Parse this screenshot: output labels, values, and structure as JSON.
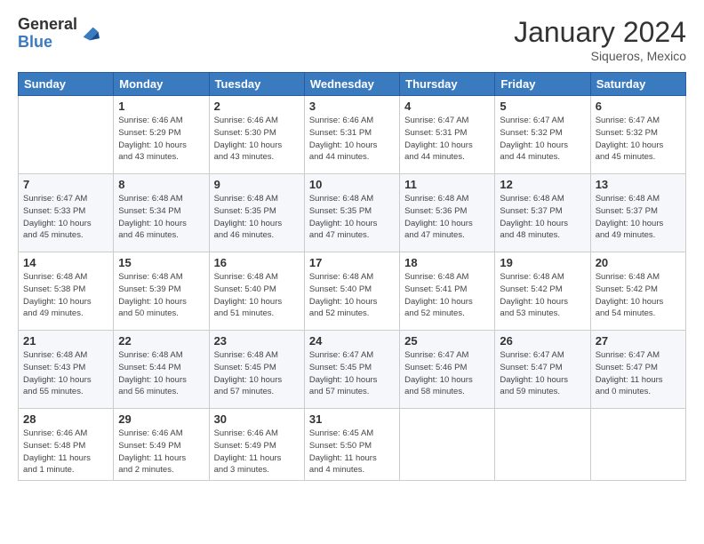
{
  "logo": {
    "general": "General",
    "blue": "Blue"
  },
  "header": {
    "month": "January 2024",
    "location": "Siqueros, Mexico"
  },
  "weekdays": [
    "Sunday",
    "Monday",
    "Tuesday",
    "Wednesday",
    "Thursday",
    "Friday",
    "Saturday"
  ],
  "weeks": [
    [
      {
        "day": "",
        "info": ""
      },
      {
        "day": "1",
        "info": "Sunrise: 6:46 AM\nSunset: 5:29 PM\nDaylight: 10 hours\nand 43 minutes."
      },
      {
        "day": "2",
        "info": "Sunrise: 6:46 AM\nSunset: 5:30 PM\nDaylight: 10 hours\nand 43 minutes."
      },
      {
        "day": "3",
        "info": "Sunrise: 6:46 AM\nSunset: 5:31 PM\nDaylight: 10 hours\nand 44 minutes."
      },
      {
        "day": "4",
        "info": "Sunrise: 6:47 AM\nSunset: 5:31 PM\nDaylight: 10 hours\nand 44 minutes."
      },
      {
        "day": "5",
        "info": "Sunrise: 6:47 AM\nSunset: 5:32 PM\nDaylight: 10 hours\nand 44 minutes."
      },
      {
        "day": "6",
        "info": "Sunrise: 6:47 AM\nSunset: 5:32 PM\nDaylight: 10 hours\nand 45 minutes."
      }
    ],
    [
      {
        "day": "7",
        "info": "Sunrise: 6:47 AM\nSunset: 5:33 PM\nDaylight: 10 hours\nand 45 minutes."
      },
      {
        "day": "8",
        "info": "Sunrise: 6:48 AM\nSunset: 5:34 PM\nDaylight: 10 hours\nand 46 minutes."
      },
      {
        "day": "9",
        "info": "Sunrise: 6:48 AM\nSunset: 5:35 PM\nDaylight: 10 hours\nand 46 minutes."
      },
      {
        "day": "10",
        "info": "Sunrise: 6:48 AM\nSunset: 5:35 PM\nDaylight: 10 hours\nand 47 minutes."
      },
      {
        "day": "11",
        "info": "Sunrise: 6:48 AM\nSunset: 5:36 PM\nDaylight: 10 hours\nand 47 minutes."
      },
      {
        "day": "12",
        "info": "Sunrise: 6:48 AM\nSunset: 5:37 PM\nDaylight: 10 hours\nand 48 minutes."
      },
      {
        "day": "13",
        "info": "Sunrise: 6:48 AM\nSunset: 5:37 PM\nDaylight: 10 hours\nand 49 minutes."
      }
    ],
    [
      {
        "day": "14",
        "info": "Sunrise: 6:48 AM\nSunset: 5:38 PM\nDaylight: 10 hours\nand 49 minutes."
      },
      {
        "day": "15",
        "info": "Sunrise: 6:48 AM\nSunset: 5:39 PM\nDaylight: 10 hours\nand 50 minutes."
      },
      {
        "day": "16",
        "info": "Sunrise: 6:48 AM\nSunset: 5:40 PM\nDaylight: 10 hours\nand 51 minutes."
      },
      {
        "day": "17",
        "info": "Sunrise: 6:48 AM\nSunset: 5:40 PM\nDaylight: 10 hours\nand 52 minutes."
      },
      {
        "day": "18",
        "info": "Sunrise: 6:48 AM\nSunset: 5:41 PM\nDaylight: 10 hours\nand 52 minutes."
      },
      {
        "day": "19",
        "info": "Sunrise: 6:48 AM\nSunset: 5:42 PM\nDaylight: 10 hours\nand 53 minutes."
      },
      {
        "day": "20",
        "info": "Sunrise: 6:48 AM\nSunset: 5:42 PM\nDaylight: 10 hours\nand 54 minutes."
      }
    ],
    [
      {
        "day": "21",
        "info": "Sunrise: 6:48 AM\nSunset: 5:43 PM\nDaylight: 10 hours\nand 55 minutes."
      },
      {
        "day": "22",
        "info": "Sunrise: 6:48 AM\nSunset: 5:44 PM\nDaylight: 10 hours\nand 56 minutes."
      },
      {
        "day": "23",
        "info": "Sunrise: 6:48 AM\nSunset: 5:45 PM\nDaylight: 10 hours\nand 57 minutes."
      },
      {
        "day": "24",
        "info": "Sunrise: 6:47 AM\nSunset: 5:45 PM\nDaylight: 10 hours\nand 57 minutes."
      },
      {
        "day": "25",
        "info": "Sunrise: 6:47 AM\nSunset: 5:46 PM\nDaylight: 10 hours\nand 58 minutes."
      },
      {
        "day": "26",
        "info": "Sunrise: 6:47 AM\nSunset: 5:47 PM\nDaylight: 10 hours\nand 59 minutes."
      },
      {
        "day": "27",
        "info": "Sunrise: 6:47 AM\nSunset: 5:47 PM\nDaylight: 11 hours\nand 0 minutes."
      }
    ],
    [
      {
        "day": "28",
        "info": "Sunrise: 6:46 AM\nSunset: 5:48 PM\nDaylight: 11 hours\nand 1 minute."
      },
      {
        "day": "29",
        "info": "Sunrise: 6:46 AM\nSunset: 5:49 PM\nDaylight: 11 hours\nand 2 minutes."
      },
      {
        "day": "30",
        "info": "Sunrise: 6:46 AM\nSunset: 5:49 PM\nDaylight: 11 hours\nand 3 minutes."
      },
      {
        "day": "31",
        "info": "Sunrise: 6:45 AM\nSunset: 5:50 PM\nDaylight: 11 hours\nand 4 minutes."
      },
      {
        "day": "",
        "info": ""
      },
      {
        "day": "",
        "info": ""
      },
      {
        "day": "",
        "info": ""
      }
    ]
  ]
}
